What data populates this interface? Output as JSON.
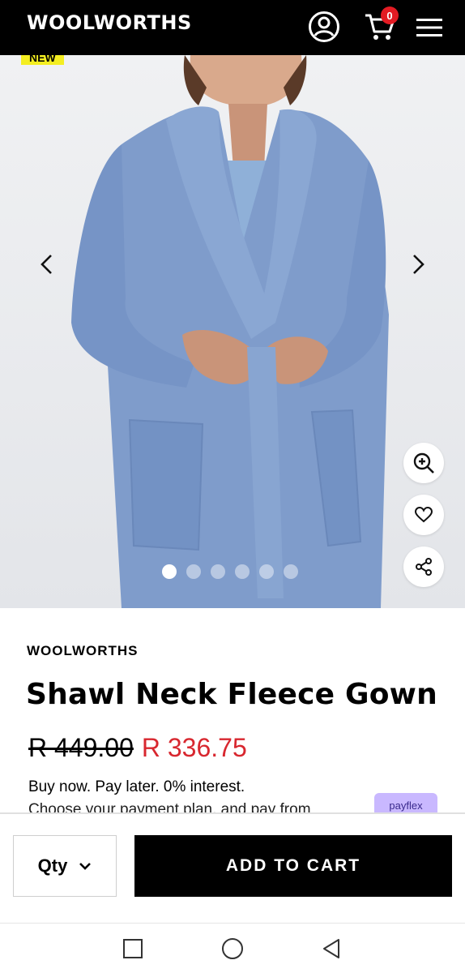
{
  "header": {
    "logo": "WOOLWORTHS",
    "cart_count": "0"
  },
  "gallery": {
    "badge": "NEW",
    "slide_count": 6,
    "active_slide": 1
  },
  "product": {
    "brand": "WOOLWORTHS",
    "title": "Shawl Neck Fleece Gown",
    "old_price": "R 449.00",
    "new_price": "R 336.75",
    "bnpl_line": "Buy now. Pay later. 0% interest.",
    "bnpl_sub": "Choose your payment plan, and pay from",
    "payflex_label": "payflex"
  },
  "actions": {
    "qty_label": "Qty",
    "add_to_cart": "ADD TO CART"
  },
  "colors": {
    "header_bg": "#000000",
    "sale_red": "#d8272f",
    "badge_yellow": "#f4ee21",
    "cart_badge_red": "#e31b23",
    "robe_blue": "#7f9ccb"
  }
}
